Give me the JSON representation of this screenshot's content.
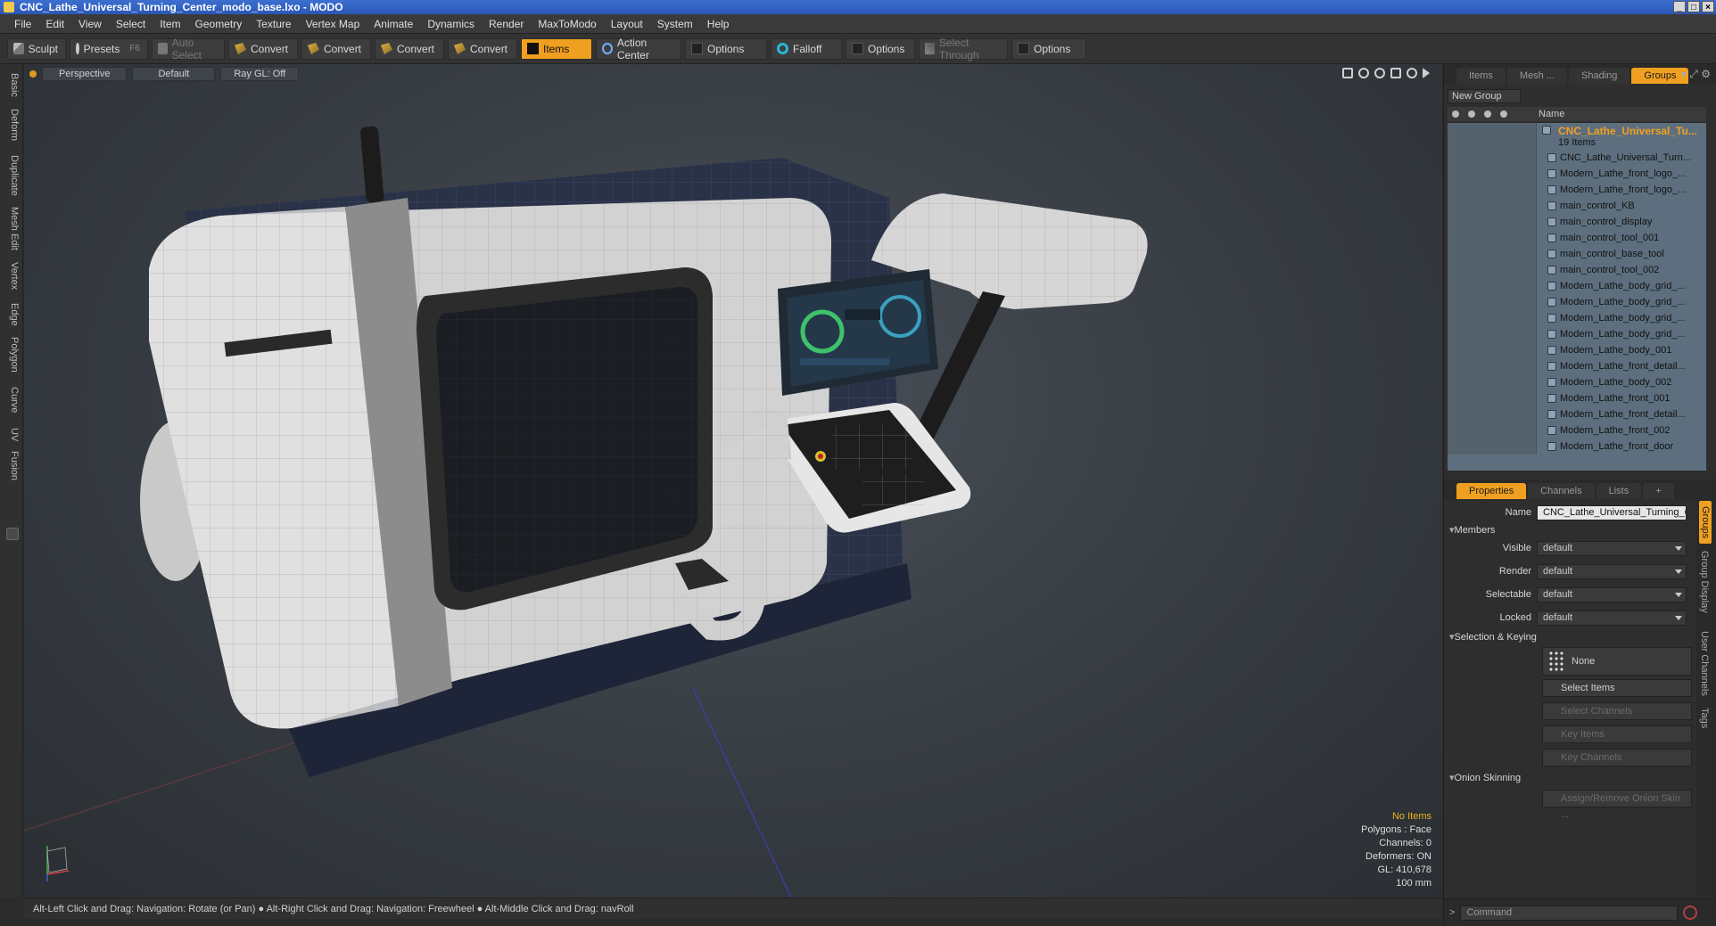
{
  "window": {
    "title": "CNC_Lathe_Universal_Turning_Center_modo_base.lxo - MODO"
  },
  "menu": [
    "File",
    "Edit",
    "View",
    "Select",
    "Item",
    "Geometry",
    "Texture",
    "Vertex Map",
    "Animate",
    "Dynamics",
    "Render",
    "MaxToModo",
    "Layout",
    "System",
    "Help"
  ],
  "toolbar": {
    "sculpt": "Sculpt",
    "presets": "Presets",
    "presets_key": "F6",
    "auto_select": "Auto Select",
    "convert": "Convert",
    "items": "Items",
    "action_center": "Action Center",
    "options": "Options",
    "falloff": "Falloff",
    "select_through": "Select Through"
  },
  "left_tabs": [
    "Basic",
    "Deform",
    "Duplicate",
    "Mesh Edit",
    "Vertex",
    "Edge",
    "Polygon",
    "Curve",
    "UV",
    "Fusion"
  ],
  "viewport": {
    "view": "Perspective",
    "shading": "Default",
    "raygl": "Ray GL: Off",
    "info": {
      "selection": "No Items",
      "polygons": "Polygons : Face",
      "channels": "Channels: 0",
      "deformers": "Deformers: ON",
      "gl": "GL: 410,678",
      "scale": "100 mm"
    }
  },
  "status": "Alt-Left Click and Drag: Navigation: Rotate (or Pan) ● Alt-Right Click and Drag: Navigation: Freewheel ● Alt-Middle Click and Drag: navRoll",
  "right_tabs": [
    "Items",
    "Mesh ...",
    "Shading",
    "Groups"
  ],
  "groups": {
    "new_group": "New Group",
    "name_header": "Name",
    "group_name": "CNC_Lathe_Universal_Tu...",
    "group_count": "19 Items",
    "items": [
      "CNC_Lathe_Universal_Turn...",
      "Modern_Lathe_front_logo_...",
      "Modern_Lathe_front_logo_...",
      "main_control_KB",
      "main_control_display",
      "main_control_tool_001",
      "main_control_base_tool",
      "main_control_tool_002",
      "Modern_Lathe_body_grid_...",
      "Modern_Lathe_body_grid_...",
      "Modern_Lathe_body_grid_...",
      "Modern_Lathe_body_grid_...",
      "Modern_Lathe_body_001",
      "Modern_Lathe_front_detail...",
      "Modern_Lathe_body_002",
      "Modern_Lathe_front_001",
      "Modern_Lathe_front_detail...",
      "Modern_Lathe_front_002",
      "Modern_Lathe_front_door"
    ]
  },
  "props_tabs": [
    "Properties",
    "Channels",
    "Lists"
  ],
  "properties": {
    "name_label": "Name",
    "name_value": "CNC_Lathe_Universal_Turning_C",
    "members": "Members",
    "visible_label": "Visible",
    "visible_value": "default",
    "render_label": "Render",
    "render_value": "default",
    "selectable_label": "Selectable",
    "selectable_value": "default",
    "locked_label": "Locked",
    "locked_value": "default",
    "selection_keying": "Selection & Keying",
    "none": "None",
    "select_items": "Select Items",
    "select_channels": "Select Channels",
    "key_items": "Key Items",
    "key_channels": "Key Channels",
    "onion_skinning": "Onion Skinning",
    "assign_onion": "Assign/Remove Onion Skin ..."
  },
  "side_tabs": [
    "Groups",
    "Group Display",
    "User Channels",
    "Tags"
  ],
  "command": {
    "placeholder": "Command"
  },
  "colors": {
    "accent": "#f0a020",
    "tree_bg": "#5d6f7e",
    "title_bar": "#3c6fd0"
  }
}
